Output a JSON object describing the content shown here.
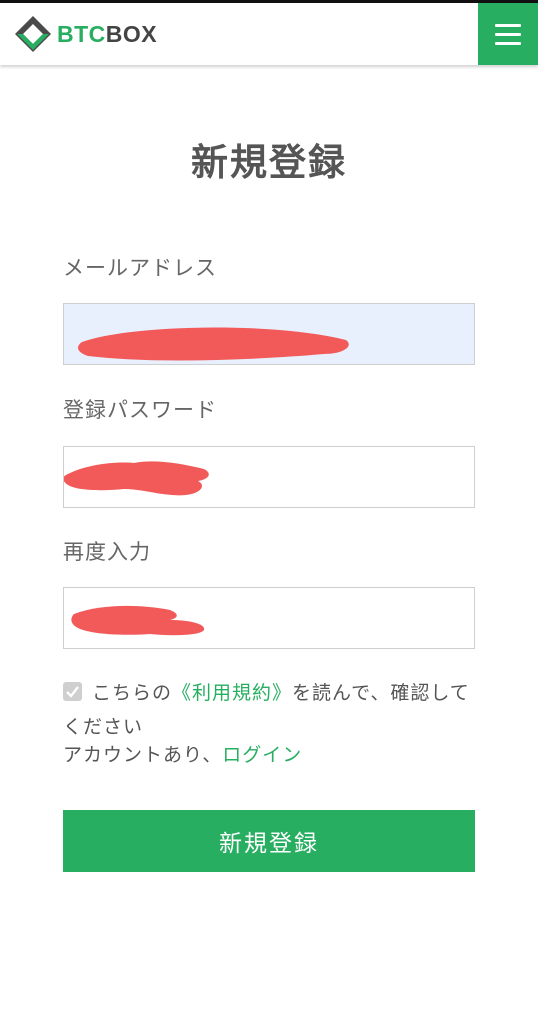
{
  "header": {
    "logo_text_green": "BTC",
    "logo_text_dark": "BOX",
    "menu_icon": "hamburger-icon"
  },
  "form": {
    "title": "新規登録",
    "email_label": "メールアドレス",
    "password_label": "登録パスワード",
    "confirm_label": "再度入力",
    "terms": {
      "prefix": "こちらの",
      "link": "《利用規約》",
      "suffix": "を読んで、確認してください",
      "checked": true
    },
    "account": {
      "text": "アカウントあり、",
      "link": "ログイン"
    },
    "submit_label": "新規登録"
  },
  "colors": {
    "brand_green": "#27ae60",
    "redaction": "#f25a5a",
    "autofill": "#e8f0fe"
  }
}
